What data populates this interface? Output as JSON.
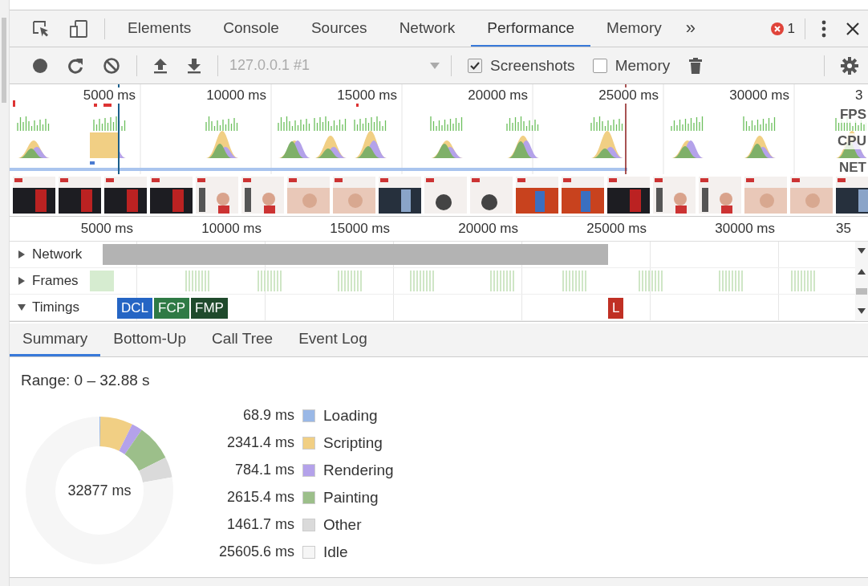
{
  "main_tabs": [
    {
      "label": "Elements",
      "selected": false
    },
    {
      "label": "Console",
      "selected": false
    },
    {
      "label": "Sources",
      "selected": false
    },
    {
      "label": "Network",
      "selected": false
    },
    {
      "label": "Performance",
      "selected": true
    },
    {
      "label": "Memory",
      "selected": false
    }
  ],
  "more_tabs": "»",
  "error_count": "1",
  "controls": {
    "target": "127.0.0.1 #1",
    "checkboxes": [
      {
        "label": "Screenshots",
        "checked": true
      },
      {
        "label": "Memory",
        "checked": false
      }
    ]
  },
  "overview": {
    "ticks": [
      "5000 ms",
      "10000 ms",
      "15000 ms",
      "20000 ms",
      "25000 ms",
      "30000 ms",
      "3"
    ],
    "lanes": [
      "FPS",
      "CPU",
      "NET"
    ]
  },
  "ruler": [
    "5000 ms",
    "10000 ms",
    "15000 ms",
    "20000 ms",
    "25000 ms",
    "30000 ms",
    "35"
  ],
  "tracks": [
    {
      "label": "Network",
      "expanded": false
    },
    {
      "label": "Frames",
      "expanded": false
    },
    {
      "label": "Timings",
      "expanded": true
    }
  ],
  "timing_markers": [
    {
      "label": "DCL",
      "kind": "early",
      "color": "#2565c4"
    },
    {
      "label": "FCP",
      "kind": "early",
      "color": "#2f7a45"
    },
    {
      "label": "FMP",
      "kind": "early",
      "color": "#1f4a2c"
    },
    {
      "label": "L",
      "kind": "load",
      "color": "#c03024"
    }
  ],
  "bottom_tabs": [
    {
      "label": "Summary",
      "selected": true
    },
    {
      "label": "Bottom-Up",
      "selected": false
    },
    {
      "label": "Call Tree",
      "selected": false
    },
    {
      "label": "Event Log",
      "selected": false
    }
  ],
  "summary": {
    "range": "Range: 0 – 32.88 s",
    "total": "32877 ms",
    "legend": [
      {
        "value": "68.9 ms",
        "color": "#9ab8e6"
      },
      {
        "value": "2341.4 ms",
        "color": "#f1cf84"
      },
      {
        "value": "784.1 ms",
        "color": "#b4a2ea"
      },
      {
        "value": "2615.4 ms",
        "color": "#9cbf8a"
      },
      {
        "value": "1461.7 ms",
        "color": "#dadada"
      },
      {
        "value": "25605.6 ms",
        "color": "#f6f6f6"
      }
    ],
    "chart_data": {
      "type": "donut",
      "categories": [
        "Loading",
        "Scripting",
        "Rendering",
        "Painting",
        "Other",
        "Idle"
      ],
      "values": [
        0.21,
        7.12,
        2.38,
        7.96,
        4.45,
        77.88
      ]
    }
  }
}
